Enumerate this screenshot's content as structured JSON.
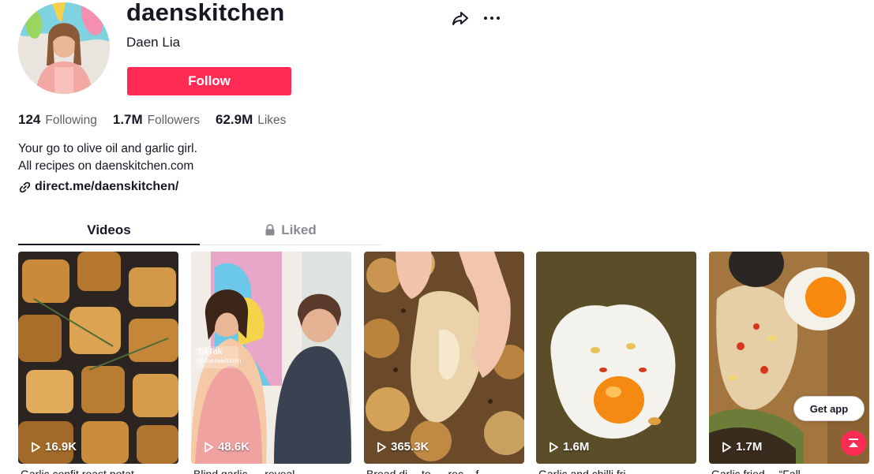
{
  "profile": {
    "username": "daenskitchen",
    "nickname": "Daen Lia",
    "follow_label": "Follow",
    "bio_lines": [
      "Your go to olive oil and garlic girl.",
      "All recipes on daenskitchen.com"
    ],
    "link": "direct.me/daenskitchen/"
  },
  "stats": [
    {
      "value": "124",
      "label": "Following"
    },
    {
      "value": "1.7M",
      "label": "Followers"
    },
    {
      "value": "62.9M",
      "label": "Likes"
    }
  ],
  "tabs": [
    {
      "label": "Videos",
      "active": true
    },
    {
      "label": "Liked",
      "active": false,
      "icon": "lock-icon"
    }
  ],
  "videos": [
    {
      "views": "16.9K",
      "caption": "Garlic confit roast potat..."
    },
    {
      "views": "48.6K",
      "caption": "Blind garlic … reveal..."
    },
    {
      "views": "365.3K",
      "caption": "Bread di… to … rec... f..."
    },
    {
      "views": "1.6M",
      "caption": "Garlic and chilli fri..."
    },
    {
      "views": "1.7M",
      "caption": "Garlic fried… “Fall..."
    }
  ],
  "overlays": {
    "get_app_label": "Get app",
    "watermark_brand": "TikTok",
    "watermark_handle": "@daenskitchen"
  },
  "colors": {
    "accent": "#fe2c55",
    "text": "#161823",
    "muted": "#5f6068"
  },
  "icons": [
    "share-icon",
    "more-icon",
    "link-icon",
    "lock-icon",
    "play-icon",
    "scroll-top-icon"
  ]
}
